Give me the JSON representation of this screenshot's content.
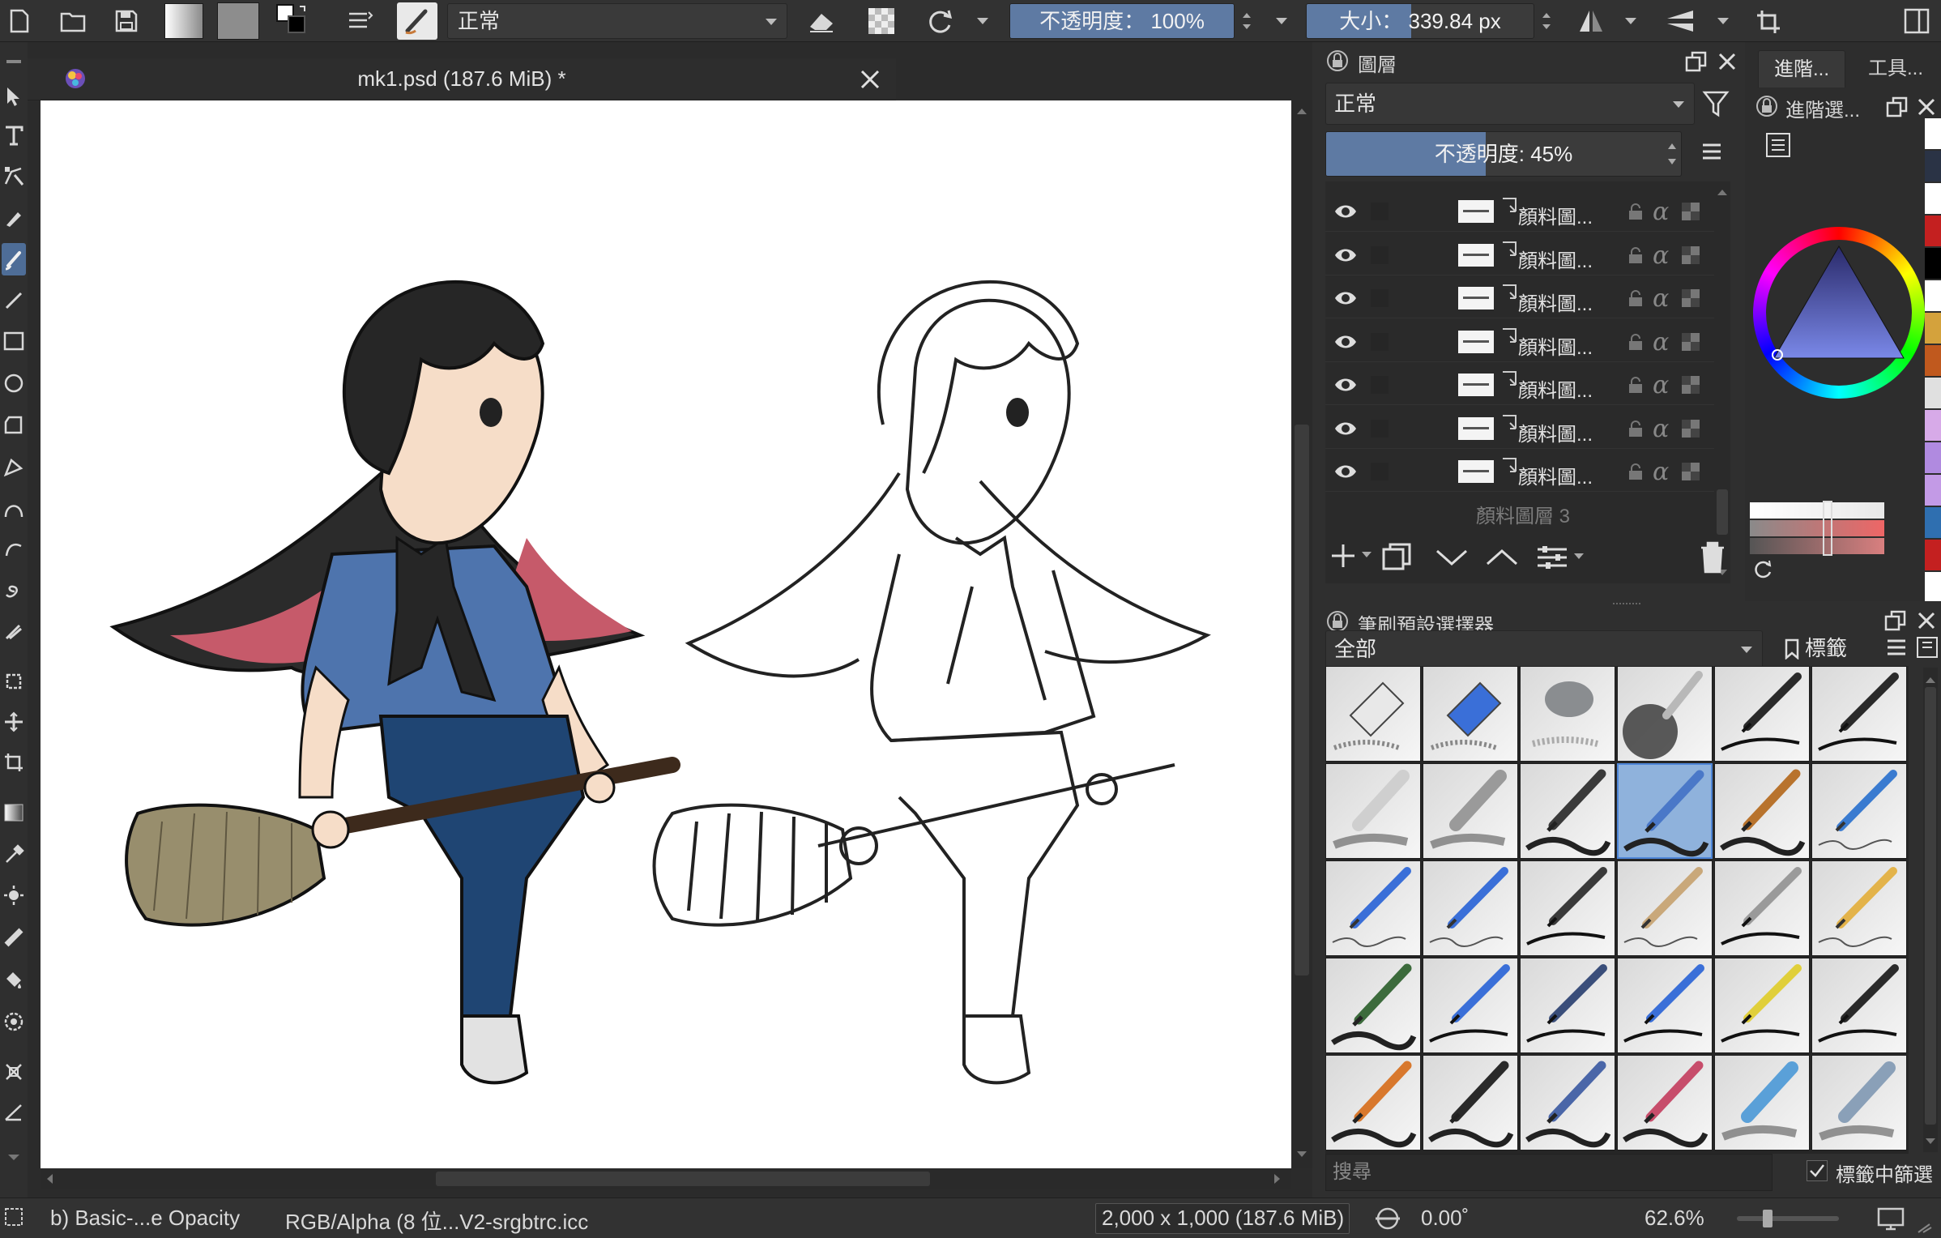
{
  "toolbar": {
    "blend_mode": "正常",
    "opacity_label": "不透明度： 100%",
    "opacity_value": 1.0,
    "size_label": "大小： 339.84 px",
    "size_value": 339.84
  },
  "document": {
    "title": "mk1.psd (187.6 MiB) *"
  },
  "layers_panel": {
    "title": "圖層",
    "blend_mode": "正常",
    "opacity_label": "不透明度:  45%",
    "opacity_value": 0.45,
    "layers": [
      {
        "name": "顏料圖..."
      },
      {
        "name": "顏料圖..."
      },
      {
        "name": "顏料圖..."
      },
      {
        "name": "顏料圖..."
      },
      {
        "name": "顏料圖..."
      },
      {
        "name": "顏料圖..."
      },
      {
        "name": "顏料圖..."
      }
    ],
    "partial_bottom_layer": "顏料圖層 3"
  },
  "side_tabs": {
    "tab1": "進階...",
    "tab2": "工具...",
    "advanced_title": "進階選..."
  },
  "brush_panel": {
    "title": "筆刷預設選擇器",
    "filter": "全部",
    "tag_button": "標籤",
    "search_placeholder": "搜尋",
    "filter_in_tag": "標籤中篩選",
    "selected_index": 9,
    "brushes": [
      {
        "kind": "eraser",
        "color": "#e8e8e8"
      },
      {
        "kind": "eraser",
        "color": "#3a6fd8"
      },
      {
        "kind": "blob",
        "color": "#8a8d90"
      },
      {
        "kind": "airbrush",
        "color": "#b8b8b8"
      },
      {
        "kind": "pen",
        "color": "#2a2a2a"
      },
      {
        "kind": "pen",
        "color": "#2a2a2a"
      },
      {
        "kind": "marker",
        "color": "#cfcfcf"
      },
      {
        "kind": "marker",
        "color": "#9a9a9a"
      },
      {
        "kind": "brushpen",
        "color": "#3a3a3a"
      },
      {
        "kind": "brushpen",
        "color": "#4a78c8"
      },
      {
        "kind": "brushpen",
        "color": "#b8732d"
      },
      {
        "kind": "pencil",
        "color": "#3a7bd0"
      },
      {
        "kind": "pencil",
        "color": "#3a6fd8"
      },
      {
        "kind": "pencil",
        "color": "#3a6fd8"
      },
      {
        "kind": "pen",
        "color": "#3a3a3a"
      },
      {
        "kind": "pencil",
        "color": "#c9a87a"
      },
      {
        "kind": "pen",
        "color": "#9a9a9a"
      },
      {
        "kind": "pencil",
        "color": "#e3b34a"
      },
      {
        "kind": "brushpen",
        "color": "#3c6b3c"
      },
      {
        "kind": "pen",
        "color": "#3a6fd8"
      },
      {
        "kind": "pen",
        "color": "#3a4e7a"
      },
      {
        "kind": "pen",
        "color": "#3a6fd8"
      },
      {
        "kind": "pen",
        "color": "#e0cf3a"
      },
      {
        "kind": "pen",
        "color": "#2a2a2a"
      },
      {
        "kind": "brushpen",
        "color": "#d8782d"
      },
      {
        "kind": "brushpen",
        "color": "#2a2a2a"
      },
      {
        "kind": "brushpen",
        "color": "#4a66a8"
      },
      {
        "kind": "brushpen",
        "color": "#c74d6b"
      },
      {
        "kind": "marker",
        "color": "#5aa0d8"
      },
      {
        "kind": "marker",
        "color": "#8aa0b8"
      }
    ]
  },
  "palette": {
    "swatches": [
      "#ffffff",
      "#2a3345",
      "#ffffff",
      "#c42020",
      "#000000",
      "#ffffff",
      "#d4a23c",
      "#c0591e",
      "#e0e0e0",
      "#d7aae8",
      "#b08ae0",
      "#c39ae6",
      "#2f6fb0",
      "#c42020",
      "#ffffff",
      "#000000"
    ]
  },
  "status": {
    "brush": "b) Basic-...e Opacity",
    "color_space": "RGB/Alpha (8 位...V2-srgbtrc.icc",
    "dimensions": "2,000 x 1,000 (187.6 MiB)",
    "rotation": "0.00˚",
    "zoom": "62.6%"
  }
}
